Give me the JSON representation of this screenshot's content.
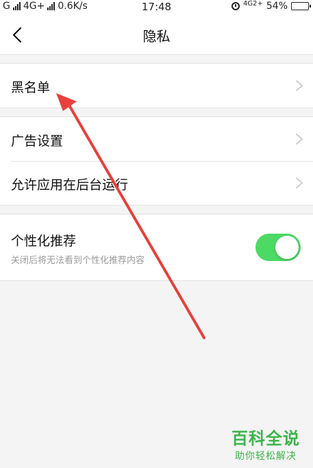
{
  "status_bar": {
    "carrier_left": "G",
    "network": "4G+",
    "speed": "0.6K/s",
    "time": "17:48",
    "network_right": "4G2+",
    "battery": "54%",
    "battery_level": 0.54
  },
  "header": {
    "title": "隐私",
    "back_icon": "chevron-left-icon"
  },
  "groups": [
    {
      "rows": [
        {
          "label": "黑名单",
          "icon": "chevron-right-icon"
        }
      ]
    },
    {
      "rows": [
        {
          "label": "广告设置",
          "icon": "chevron-right-icon"
        },
        {
          "label": "允许应用在后台运行",
          "icon": "chevron-right-icon"
        }
      ]
    },
    {
      "toggle": {
        "title": "个性化推荐",
        "description": "关闭后将无法看到个性化推荐内容",
        "enabled": true
      }
    }
  ],
  "watermark": {
    "title": "百科全说",
    "subtitle": "助你轻松解决"
  },
  "colors": {
    "toggle_on": "#4cd964",
    "annotation_arrow": "#e8403a",
    "watermark": "#3cb54a"
  }
}
